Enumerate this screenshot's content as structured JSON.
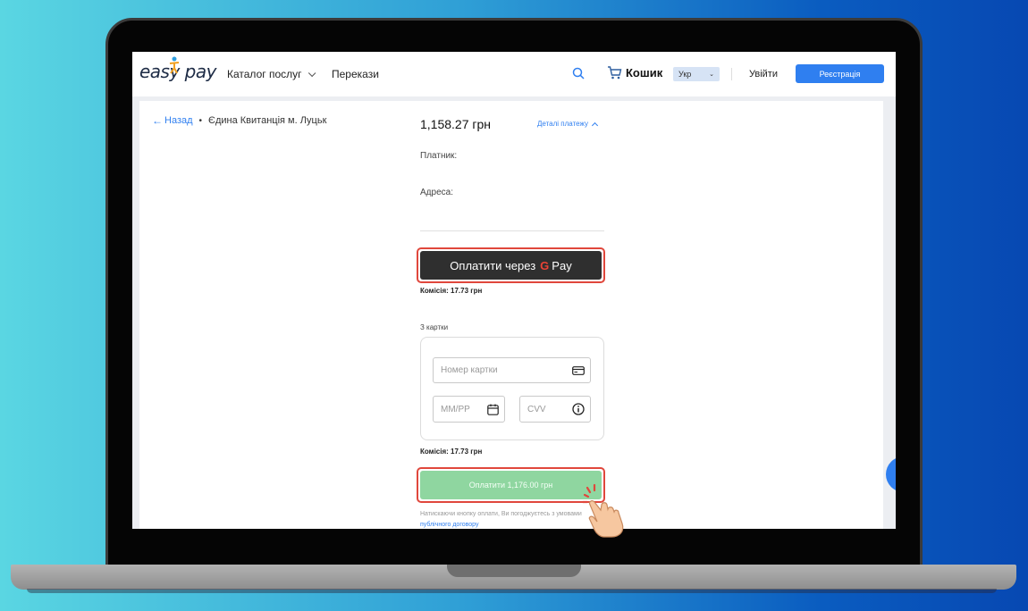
{
  "header": {
    "logo": "easy pay",
    "nav": {
      "catalog": "Каталог послуг",
      "transfers": "Перекази"
    },
    "cart_label": "Кошик",
    "language": "Укр",
    "login": "Увійти",
    "register": "Реєстрація"
  },
  "breadcrumb": {
    "back": "Назад",
    "current": "Єдина Квитанція м. Луцьк"
  },
  "payment": {
    "amount": "1,158.27 грн",
    "details_link": "Деталі платежу",
    "payer_label": "Платник:",
    "address_label": "Адреса:",
    "gpay_label": "Оплатити через",
    "gpay_g": "G",
    "gpay_pay": "Pay",
    "commission_gpay": "Комісія:  17.73 грн",
    "card_section_label": "З картки",
    "card_number_placeholder": "Номер картки",
    "expiry_placeholder": "ММ/РР",
    "cvv_placeholder": "CVV",
    "commission_card": "Комісія:  17.73 грн",
    "pay_button": "Оплатити 1,176.00 грн",
    "terms_text": "Натискаючи кнопку оплати, Ви погоджуєтесь з умовами",
    "terms_link": "публічного договору"
  },
  "colors": {
    "accent": "#2f7ff0",
    "highlight": "#e0473c",
    "pay_button": "#8fd6a0",
    "gpay_button": "#2f2f2f"
  }
}
